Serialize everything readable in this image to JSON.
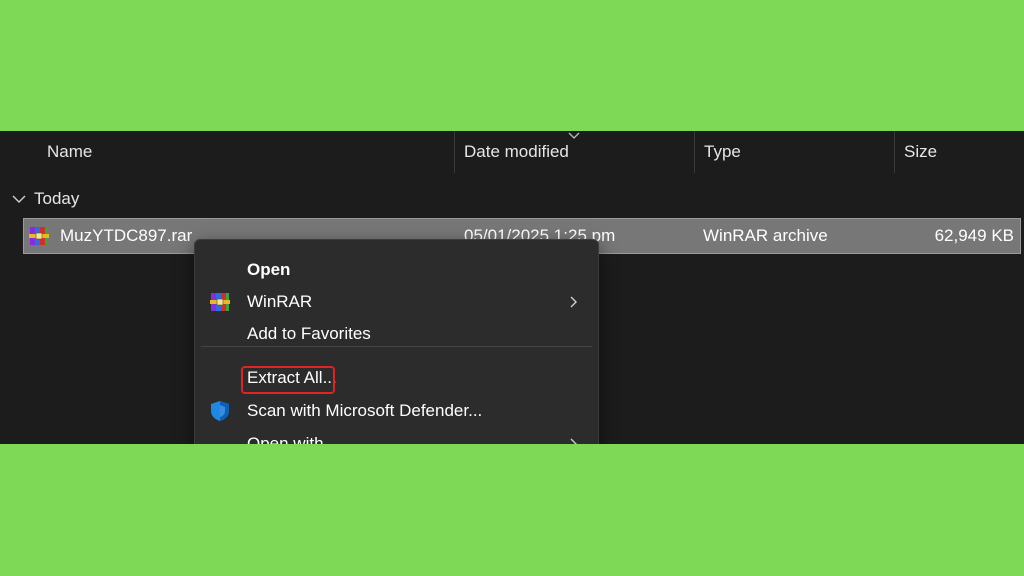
{
  "columns": {
    "name": "Name",
    "date_modified": "Date modified",
    "type": "Type",
    "size": "Size"
  },
  "group": {
    "label": "Today"
  },
  "file": {
    "name": "MuzYTDC897.rar",
    "date_modified": "05/01/2025 1:25 pm",
    "type": "WinRAR archive",
    "size": "62,949 KB",
    "icon": "winrar-archive-icon"
  },
  "context_menu": {
    "items": [
      {
        "label": "Open",
        "bold": true
      },
      {
        "label": "WinRAR",
        "icon": "winrar-icon",
        "submenu": true
      },
      {
        "label": "Add to Favorites"
      },
      {
        "label": "Extract All...",
        "highlighted": true
      },
      {
        "label": "Scan with Microsoft Defender...",
        "icon": "defender-shield-icon"
      },
      {
        "label": "Open with",
        "submenu": true
      }
    ]
  },
  "colors": {
    "background": "#7ed957",
    "explorer_bg": "#1c1c1c",
    "selection": "#777777",
    "menu_bg": "#2c2c2c",
    "highlight_border": "#e02424"
  }
}
